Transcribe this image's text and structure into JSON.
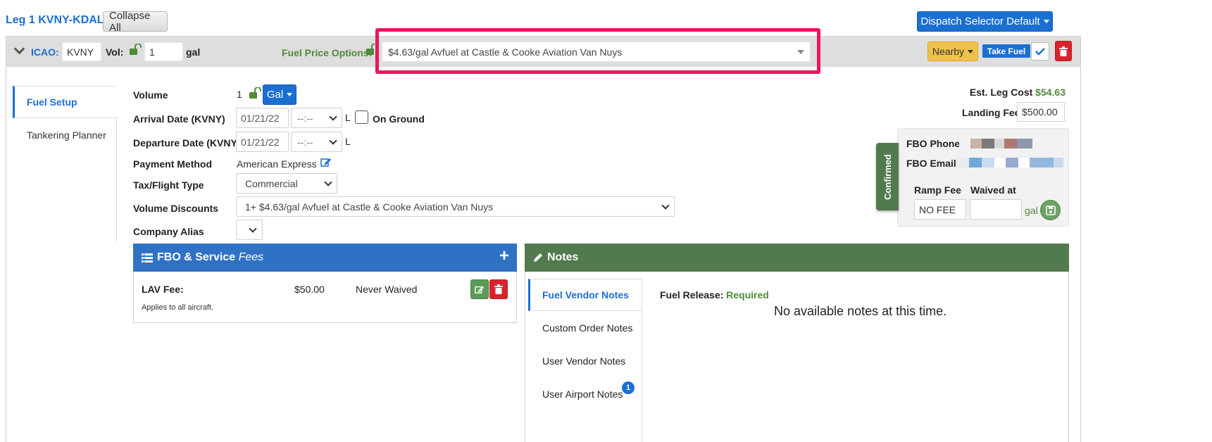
{
  "leg": {
    "title": "Leg 1 KVNY-KDAL",
    "collapse_label": "Collapse All",
    "dispatch_label": "Dispatch Selector Default"
  },
  "bar": {
    "icao_label": "ICAO:",
    "icao_value": "KVNY",
    "vol_label": "Vol:",
    "vol_value": "1",
    "gal_label": "gal",
    "fuel_price_label": "Fuel Price Options:",
    "fuel_price_value": "$4.63/gal Avfuel at Castle & Cooke Aviation Van Nuys",
    "nearby_label": "Nearby",
    "take_fuel_label": "Take Fuel"
  },
  "tabs": [
    {
      "label": "Fuel Setup"
    },
    {
      "label": "Tankering Planner"
    }
  ],
  "form": {
    "volume_label": "Volume",
    "volume_value": "1",
    "unit_label": "Gal",
    "arrival_label": "Arrival Date (KVNY)",
    "arrival_date": "01/21/22",
    "arrival_time": "--:--",
    "l_suffix": "L",
    "on_ground_label": "On Ground",
    "departure_label": "Departure Date (KVNY)",
    "departure_date": "01/21/22",
    "departure_time": "--:--",
    "payment_label": "Payment Method",
    "payment_value": "American Express",
    "tax_label": "Tax/Flight Type",
    "tax_value": "Commercial",
    "discounts_label": "Volume Discounts",
    "discounts_value": "1+ $4.63/gal Avfuel at Castle & Cooke Aviation Van Nuys",
    "alias_label": "Company Alias",
    "alias_value": ""
  },
  "right": {
    "est_cost_label": "Est. Leg Cost",
    "est_cost_value": "$54.63",
    "landing_label": "Landing Fee",
    "landing_value": "$500.00",
    "fbo_phone_label": "FBO Phone:",
    "fbo_email_label": "FBO Email:",
    "confirmed_label": "Confirmed",
    "ramp_label": "Ramp Fee",
    "waived_label": "Waived at",
    "ramp_value": "NO FEE",
    "waived_value": "",
    "gal_label": "gal"
  },
  "fees": {
    "header_strong": "FBO & Service ",
    "header_em": "Fees",
    "rows": [
      {
        "name": "LAV Fee:",
        "amount": "$50.00",
        "waived": "Never Waived",
        "note": "Applies to all aircraft."
      }
    ]
  },
  "notes": {
    "header": "Notes",
    "tabs": [
      {
        "label": "Fuel Vendor Notes"
      },
      {
        "label": "Custom Order Notes"
      },
      {
        "label": "User Vendor Notes"
      },
      {
        "label": "User Airport Notes",
        "badge": "1"
      }
    ],
    "fuel_release_label": "Fuel Release:",
    "fuel_release_value": "Required",
    "empty_text": "No available notes at this time."
  },
  "colors": {
    "accent_blue": "#1a6fd1",
    "header_green": "#527a4f",
    "highlight_pink": "#e8175d",
    "delete_red": "#d9232d",
    "nearby_yellow": "#f0c24b"
  }
}
